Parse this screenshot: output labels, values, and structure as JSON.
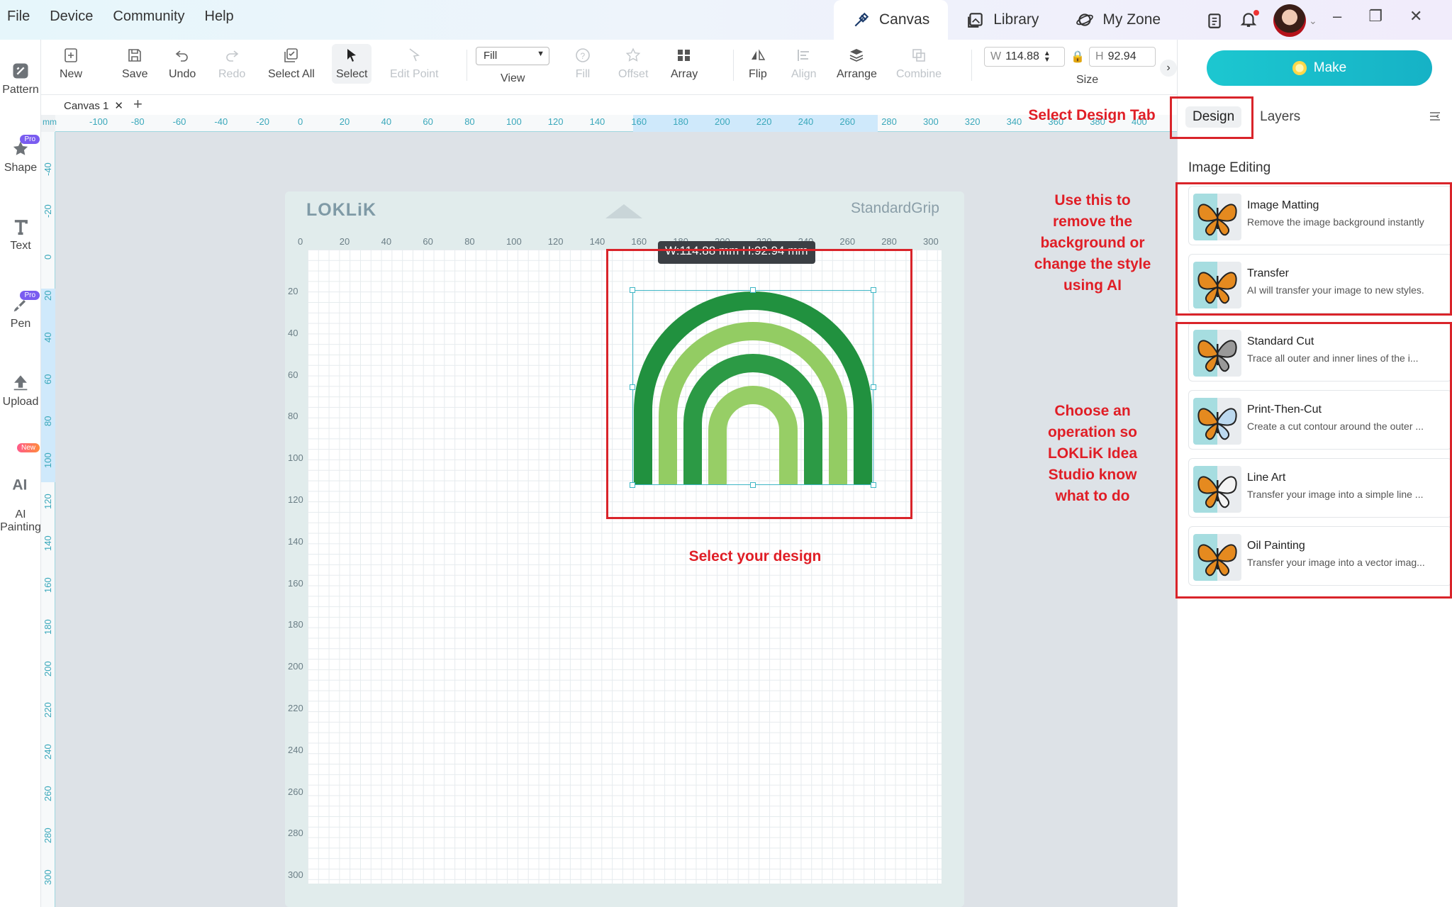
{
  "menu": [
    "File",
    "Device",
    "Community",
    "Help"
  ],
  "tabs": [
    {
      "label": "Canvas",
      "icon": "canvas-icon",
      "active": true
    },
    {
      "label": "Library",
      "icon": "library-icon",
      "active": false
    },
    {
      "label": "My Zone",
      "icon": "my-zone-icon",
      "active": false
    }
  ],
  "rail": [
    {
      "label": "Pattern",
      "icon": "pattern-icon"
    },
    {
      "label": "Shape",
      "icon": "star-icon",
      "badge": "Pro"
    },
    {
      "label": "Text",
      "icon": "text-icon"
    },
    {
      "label": "Pen",
      "icon": "pen-icon",
      "badge": "Pro"
    },
    {
      "label": "Upload",
      "icon": "upload-icon"
    },
    {
      "label": "AI\nPainting",
      "icon": "ai-painting-icon",
      "badge": "New"
    }
  ],
  "toolbar": {
    "new": "New",
    "save": "Save",
    "undo": "Undo",
    "redo": "Redo",
    "select_all": "Select All",
    "select": "Select",
    "edit_point": "Edit Point",
    "view_value": "Fill",
    "view": "View",
    "fill": "Fill",
    "offset": "Offset",
    "array": "Array",
    "flip": "Flip",
    "align": "Align",
    "arrange": "Arrange",
    "combine": "Combine",
    "width_label": "W",
    "width": "114.88",
    "height_label": "H",
    "height": "92.94",
    "size": "Size"
  },
  "canvas_tab": "Canvas 1",
  "ruler": {
    "unit": "mm",
    "x": [
      "-100",
      "-80",
      "-60",
      "-40",
      "-20",
      "0",
      "20",
      "40",
      "60",
      "80",
      "100",
      "120",
      "140",
      "160",
      "180",
      "200",
      "220",
      "240",
      "260",
      "280",
      "300",
      "320",
      "340",
      "360",
      "380",
      "400"
    ],
    "y": [
      "-40",
      "-20",
      "0",
      "20",
      "40",
      "60",
      "80",
      "100",
      "120",
      "140",
      "160",
      "180",
      "200",
      "220",
      "240",
      "260",
      "280",
      "300"
    ]
  },
  "mat": {
    "brand": "LOKLiK",
    "name": "StandardGrip",
    "x_ticks": [
      "0",
      "20",
      "40",
      "60",
      "80",
      "100",
      "120",
      "140",
      "160",
      "180",
      "200",
      "220",
      "240",
      "260",
      "280",
      "300"
    ],
    "y_ticks": [
      "20",
      "40",
      "60",
      "80",
      "100",
      "120",
      "140",
      "160",
      "180",
      "200",
      "220",
      "240",
      "260",
      "280",
      "300"
    ]
  },
  "selection": {
    "dims": "W:114.88 mm  H:92.94 mm"
  },
  "design": {
    "colors": [
      "#21913f",
      "#93cc63",
      "#2c9a45",
      "#97ce66"
    ]
  },
  "make_button": "Make",
  "panel": {
    "tabs": [
      "Design",
      "Layers"
    ],
    "section_title": "Image Editing",
    "cards": [
      {
        "title": "Image Matting",
        "desc": "Remove the image background instantly"
      },
      {
        "title": "Transfer",
        "desc": "AI will transfer your image to new styles."
      },
      {
        "title": "Standard Cut",
        "desc": "Trace all outer and inner lines of the i..."
      },
      {
        "title": "Print-Then-Cut",
        "desc": "Create a cut contour around the outer ..."
      },
      {
        "title": "Line Art",
        "desc": "Transfer your image into a simple line ..."
      },
      {
        "title": "Oil Painting",
        "desc": "Transfer your image into a vector imag..."
      }
    ]
  },
  "annotations": {
    "select_tab": "Select Design Tab",
    "use_this": "Use this to\nremove the\nbackground or\nchange the style\nusing AI",
    "choose_op": "Choose an\noperation so\nLOKLiK Idea\nStudio know\nwhat to do",
    "select_design": "Select your design"
  },
  "colors": {
    "accent": "#17bcc9",
    "annotation": "#e01e26",
    "ruler": "#3aa8bb"
  }
}
